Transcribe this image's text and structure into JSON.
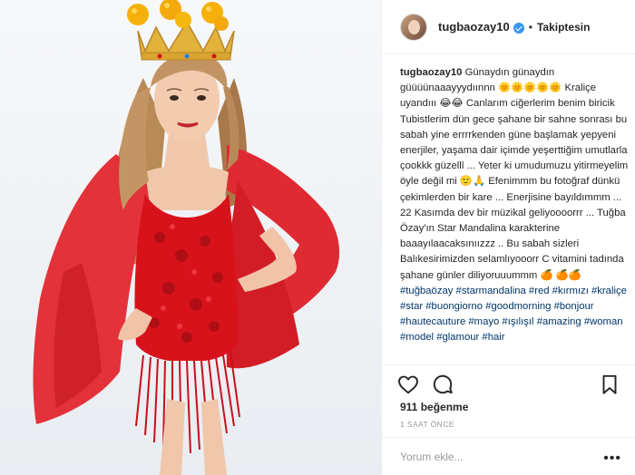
{
  "post": {
    "username": "tugbaozay10",
    "follow_status": "Takiptesin",
    "separator": "•",
    "caption_user": "tugbaozay10",
    "caption_text": " Günaydın günaydın güüüünaaayyydıınnn 🌞🌞🌞🌞🌞 Kraliçe uyandııı 😂😂 Canlarım ciğerlerim benim biricik Tubistlerim dün gece şahane bir sahne sonrası bu sabah yine errrrkenden güne başlamak yepyeni enerjiler, yaşama dair içimde yeşerttiğim umutlarla çookkk güzelll ... Yeter ki umudumuzu yitirmeyelim öyle değil mi 🙂🙏 Efenimmm bu fotoğraf dünkü çekimlerden bir kare ... Enerjisine bayıldımmm ... 22 Kasımda dev bir müzikal geliyoooorrr ... Tuğba Özay'ın Star Mandalina karakterine baaayılaacaksınıızzz .. Bu sabah sizleri Balıkesirimizden selamlıyooorr C vitamini tadında şahane günler diliyoruuummm 🍊",
    "hashtags": "🍊🍊 #tuğbaözay #starmandalina #red #kırmızı #kraliçe #star #buongiorno #goodmorning #bonjour #hautecauture #mayo #ışılışıl #amazing #woman #model #glamour #hair",
    "likes": "911 beğenme",
    "time_ago": "1 SAAT ÖNCE",
    "comment_placeholder": "Yorum ekle...",
    "more_label": "•••"
  },
  "icons": {
    "like": "heart-icon",
    "comment": "comment-icon",
    "save": "bookmark-icon",
    "verified": "verified-badge-icon",
    "more": "more-options-icon"
  },
  "colors": {
    "dress": "#d8121b",
    "crown": "#e2b23a",
    "oranges": "#f4b400",
    "hashtag": "#003569",
    "verified": "#3897f0"
  }
}
